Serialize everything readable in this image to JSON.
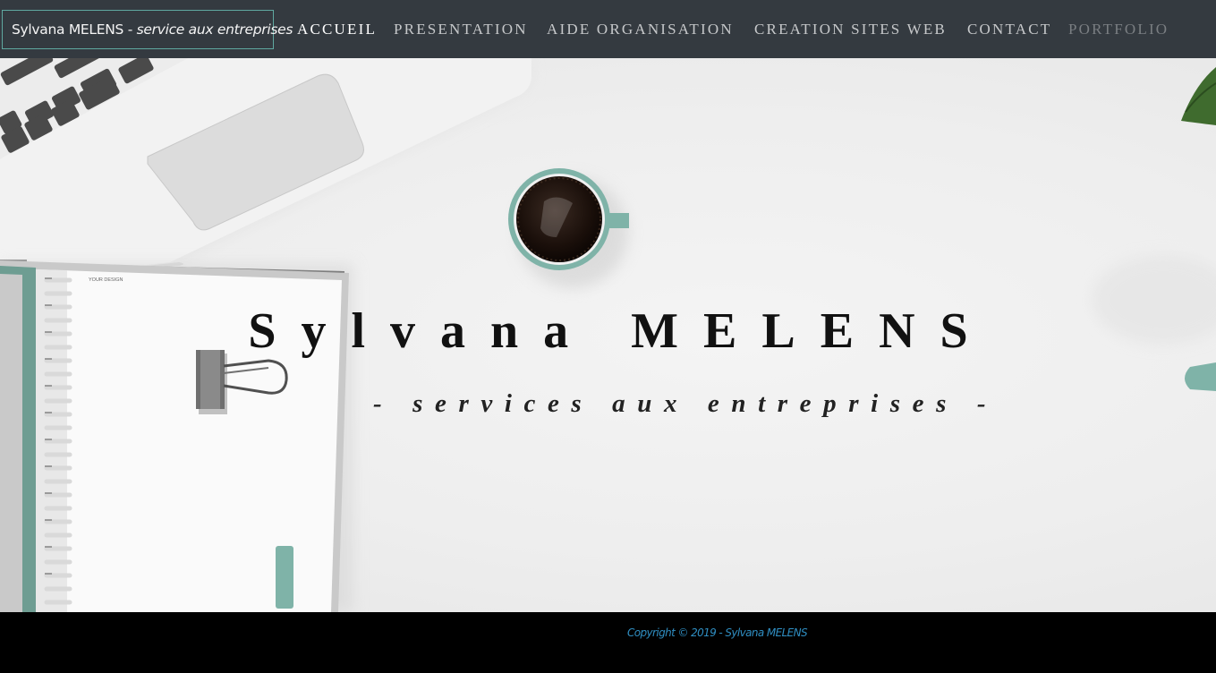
{
  "brand": {
    "name": "Sylvana MELENS - ",
    "tagline": "service aux entreprises"
  },
  "nav": {
    "items": [
      {
        "label": "ACCUEIL",
        "state": "active"
      },
      {
        "label": "PRESENTATION",
        "state": "normal"
      },
      {
        "label": "AIDE ORGANISATION",
        "state": "normal"
      },
      {
        "label": "CREATION SITES WEB",
        "state": "normal"
      },
      {
        "label": "CONTACT",
        "state": "normal"
      },
      {
        "label": "PORTFOLIO",
        "state": "muted"
      }
    ]
  },
  "hero": {
    "title": "Sylvana MELENS",
    "subtitle": "- services aux entreprises -",
    "notebook_label": "YOUR DESIGN"
  },
  "footer": {
    "copyright": "Copyright © 2019 - Sylvana MELENS"
  },
  "colors": {
    "navbar": "#343a40",
    "brand_border": "#5fa8a0",
    "footer": "#000000",
    "copyright": "#2f8ec2",
    "accent_mint": "#7fb3a8"
  }
}
